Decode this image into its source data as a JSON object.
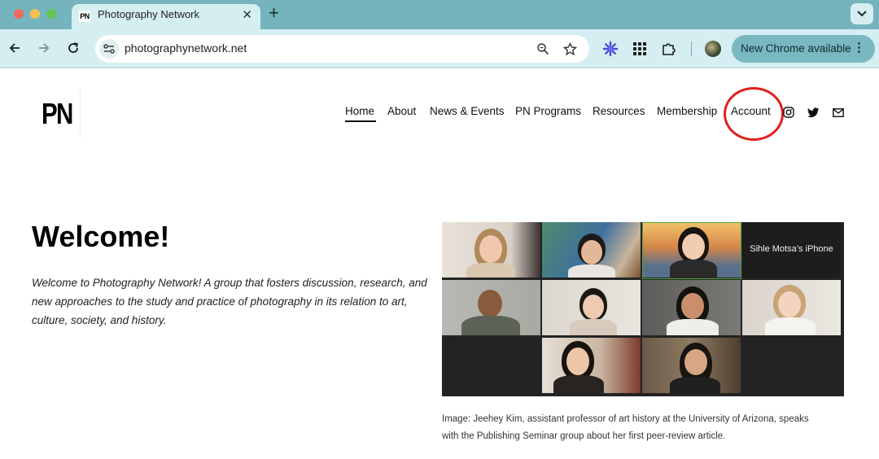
{
  "browser": {
    "tab_title": "Photography Network",
    "tab_favicon_text": "PN",
    "url": "photographynetwork.net",
    "update_label": "New Chrome available",
    "icons": [
      "back-icon",
      "forward-icon",
      "reload-icon",
      "site-info-icon",
      "zoom-icon",
      "bookmark-star-icon",
      "extension-icon",
      "apps-grid-icon",
      "puzzle-icon",
      "profile-avatar",
      "more-icon"
    ]
  },
  "site": {
    "logo": "PN",
    "nav": {
      "home": "Home",
      "about": "About",
      "news_events": "News & Events",
      "pn_programs": "PN Programs",
      "resources": "Resources",
      "membership": "Membership",
      "account": "Account"
    },
    "social_icons": [
      "instagram-icon",
      "twitter-icon",
      "email-icon"
    ],
    "active_nav": "Home",
    "highlight_color": "#e0201d"
  },
  "main": {
    "title": "Welcome!",
    "intro": "Welcome to Photography Network! A group that fosters discussion, research, and new approaches to the study and practice of photography in its relation to art, culture, society, and history.",
    "zoom_grid": {
      "participant_name": "Sihle Motsa’s iPhone",
      "participants_with_video": 10
    },
    "caption_line1": "Image: Jeehey Kim, assistant professor of art history at the University of Arizona, speaks",
    "caption_line2": "with the Publishing Seminar group about her first peer-review article."
  }
}
